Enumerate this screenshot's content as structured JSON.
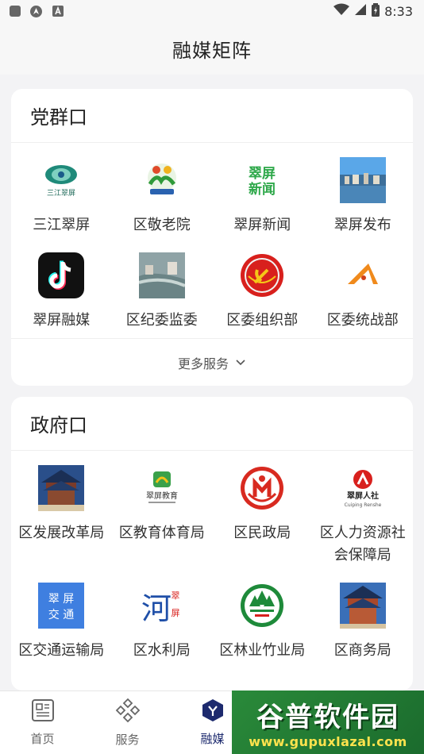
{
  "status_bar": {
    "time": "8:33"
  },
  "header": {
    "title": "融媒矩阵"
  },
  "party_section": {
    "title": "党群口",
    "items": [
      {
        "label": "三江翠屏",
        "icon": "sanjiang-cuiping-logo-icon"
      },
      {
        "label": "区敬老院",
        "icon": "elderly-home-logo-icon"
      },
      {
        "label": "翠屏新闻",
        "icon": "cuiping-news-logo-icon"
      },
      {
        "label": "翠屏发布",
        "icon": "cuiping-release-logo-icon"
      },
      {
        "label": "翠屏融媒",
        "icon": "tiktok-logo-icon"
      },
      {
        "label": "区纪委监委",
        "icon": "discipline-commission-logo-icon"
      },
      {
        "label": "区委组织部",
        "icon": "party-emblem-icon"
      },
      {
        "label": "区委统战部",
        "icon": "united-front-logo-icon"
      }
    ],
    "more_label": "更多服务"
  },
  "gov_section": {
    "title": "政府口",
    "items": [
      {
        "label": "区发展改革局",
        "icon": "development-reform-logo-icon"
      },
      {
        "label": "区教育体育局",
        "icon": "education-sports-logo-icon"
      },
      {
        "label": "区民政局",
        "icon": "civil-affairs-logo-icon"
      },
      {
        "label": "区人力资源社会保障局",
        "icon": "human-resources-logo-icon"
      },
      {
        "label": "区交通运输局",
        "icon": "transport-logo-icon"
      },
      {
        "label": "区水利局",
        "icon": "water-resources-logo-icon"
      },
      {
        "label": "区林业竹业局",
        "icon": "forestry-logo-icon"
      },
      {
        "label": "区商务局",
        "icon": "commerce-logo-icon"
      }
    ]
  },
  "bottom_nav": [
    {
      "label": "首页",
      "icon": "home-doc-icon"
    },
    {
      "label": "服务",
      "icon": "services-diamond-icon"
    },
    {
      "label": "融媒",
      "icon": "media-hex-icon",
      "active": true
    }
  ],
  "watermark": {
    "title": "谷普软件园",
    "url": "www.gupuxlazal.com"
  },
  "colors": {
    "accent": "#1d2a6e",
    "background": "#f3f3f5",
    "card": "#ffffff"
  }
}
